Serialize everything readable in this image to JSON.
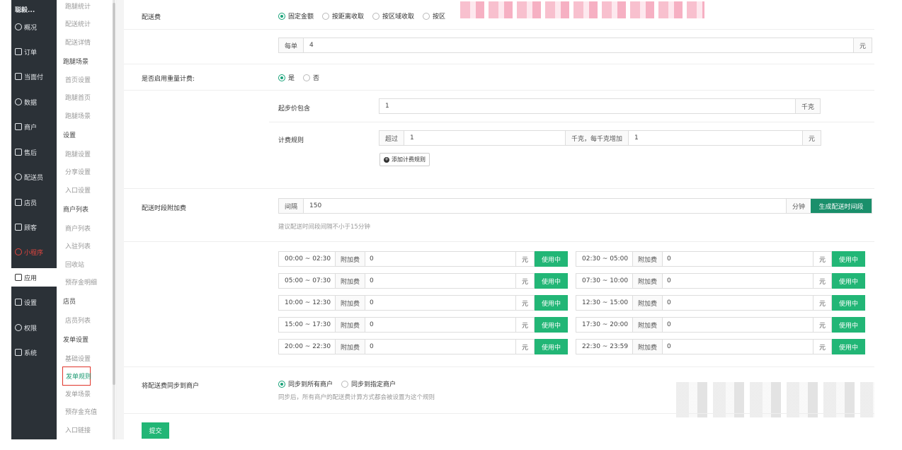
{
  "sidebar": {
    "top": "聪毅...",
    "items": [
      {
        "label": "概况",
        "icon": "overview-icon"
      },
      {
        "label": "订单",
        "icon": "order-icon"
      },
      {
        "label": "当面付",
        "icon": "pay-icon"
      },
      {
        "label": "数据",
        "icon": "data-icon"
      },
      {
        "label": "商户",
        "icon": "merchant-icon"
      },
      {
        "label": "售后",
        "icon": "aftersale-icon"
      },
      {
        "label": "配送员",
        "icon": "courier-icon"
      },
      {
        "label": "店员",
        "icon": "clerk-icon"
      },
      {
        "label": "顾客",
        "icon": "customer-icon"
      },
      {
        "label": "小程序",
        "icon": "miniapp-icon"
      },
      {
        "label": "应用",
        "icon": "apps-icon"
      },
      {
        "label": "设置",
        "icon": "settings-icon"
      },
      {
        "label": "权限",
        "icon": "permission-icon"
      },
      {
        "label": "系统",
        "icon": "system-icon"
      }
    ]
  },
  "submenu": [
    "跑腿统计",
    "配送统计",
    "配送详情",
    "跑腿场景",
    "首页设置",
    "跑腿首页",
    "跑腿场景",
    "设置",
    "跑腿设置",
    "分享设置",
    "入口设置",
    "商户列表",
    "商户列表",
    "入驻列表",
    "回收站",
    "预存金明细",
    "店员",
    "店员列表",
    "发单设置",
    "基础设置",
    "发单规则",
    "发单场景",
    "预存金充值",
    "入口链接"
  ],
  "delivery_fee": {
    "label": "配送费",
    "options": [
      "固定金额",
      "按距离收取",
      "按区域收取",
      "按区"
    ],
    "per_order_label": "每单",
    "per_order_value": "4",
    "unit": "元"
  },
  "weight_fee": {
    "label": "是否启用重量计费:",
    "options": [
      "是",
      "否"
    ],
    "base_label": "起步价包含",
    "base_value": "1",
    "base_unit": "千克",
    "rule_label": "计费规则",
    "exceed_label": "超过",
    "exceed_value": "1",
    "step_label": "千克，每千克增加",
    "step_value": "1",
    "step_unit": "元",
    "add_rule_button": "添加计费规则"
  },
  "time_fee": {
    "label": "配送时段附加费",
    "interval_label": "间隔",
    "interval_value": "150",
    "interval_unit": "分钟",
    "generate_button": "生成配送时间段",
    "hint": "建议配送时间段间隔不小于15分钟",
    "extra_label": "附加费",
    "yuan": "元",
    "status": "使用中",
    "slots": [
      {
        "range": "00:00 ~ 02:30",
        "fee": "0"
      },
      {
        "range": "02:30 ~ 05:00",
        "fee": "0"
      },
      {
        "range": "05:00 ~ 07:30",
        "fee": "0"
      },
      {
        "range": "07:30 ~ 10:00",
        "fee": "0"
      },
      {
        "range": "10:00 ~ 12:30",
        "fee": "0"
      },
      {
        "range": "12:30 ~ 15:00",
        "fee": "0"
      },
      {
        "range": "15:00 ~ 17:30",
        "fee": "0"
      },
      {
        "range": "17:30 ~ 20:00",
        "fee": "0"
      },
      {
        "range": "20:00 ~ 22:30",
        "fee": "0"
      },
      {
        "range": "22:30 ~ 23:59",
        "fee": "0"
      }
    ]
  },
  "sync": {
    "label": "将配送费同步到商户",
    "options": [
      "同步到所有商户",
      "同步到指定商户"
    ],
    "hint": "同步后，所有商户的配送费计算方式都会被设置为这个规则"
  },
  "submit_label": "提交",
  "colors": {
    "sidebar_bg": "#2b3137",
    "accent": "#22b676",
    "highlight_border": "#e0352b"
  }
}
